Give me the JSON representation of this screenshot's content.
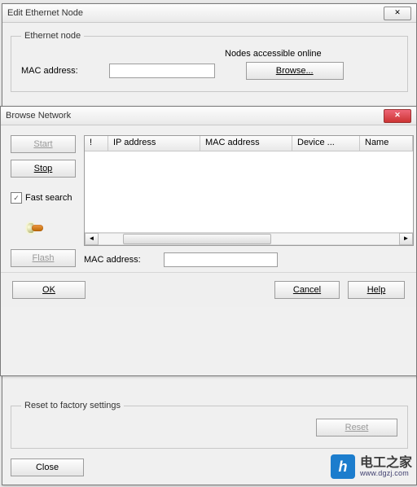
{
  "editWin": {
    "title": "Edit Ethernet Node",
    "close": "✕",
    "group": {
      "legend": "Ethernet node",
      "macLabel": "MAC address:",
      "macValue": "",
      "accessible": "Nodes accessible online",
      "browseBtn": "Browse..."
    },
    "resetGroup": {
      "legend": "Reset to factory settings",
      "resetBtn": "Reset"
    },
    "closeBtn": "Close"
  },
  "browseWin": {
    "title": "Browse Network",
    "close": "✕",
    "side": {
      "start": "Start",
      "stop": "Stop",
      "fast": "Fast search",
      "fastChecked": "✓",
      "flash": "Flash"
    },
    "cols": {
      "bang": "!",
      "ip": "IP address",
      "mac": "MAC address",
      "dev": "Device ...",
      "name": "Name"
    },
    "scroll": {
      "left": "◄",
      "right": "►",
      "thumb": "≡"
    },
    "macLabel": "MAC address:",
    "macValue": "",
    "buttons": {
      "ok": "OK",
      "cancel": "Cancel",
      "help": "Help"
    }
  },
  "watermark": {
    "logo": "h",
    "cn": "电工之家",
    "url": "www.dgzj.com"
  }
}
